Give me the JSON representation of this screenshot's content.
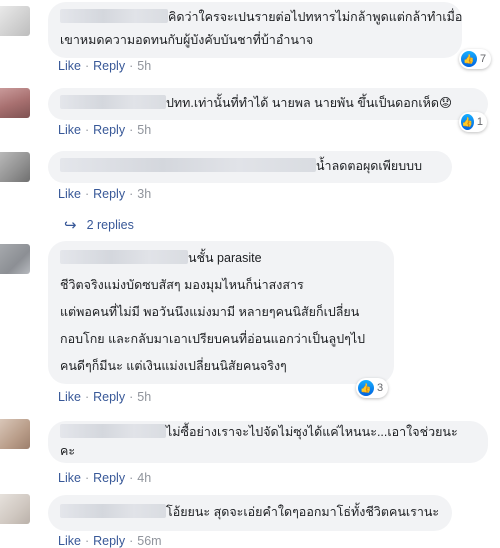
{
  "comments": [
    {
      "lines": [
        "คิดว่าใครจะเปนรายต่อไปทหารไม่กล้าพูดแต่กล้าทำเมื่อ",
        "เขาหมดความอดทนกับผู้บังคับบันชาที่บ้าอำนาจ"
      ],
      "reactions": "7",
      "like": "Like",
      "reply": "Reply",
      "time": "5h"
    },
    {
      "lines": [
        "ปทท.เท่านั้นที่ทำได้ นายพล นายพัน ขึ้นเป็นดอกเห็ด😟"
      ],
      "reactions": "1",
      "like": "Like",
      "reply": "Reply",
      "time": "5h"
    },
    {
      "lines": [
        "น้ำลดตอผุดเพียบบบ"
      ],
      "like": "Like",
      "reply": "Reply",
      "time": "3h",
      "replies_label": "2 replies"
    },
    {
      "lines": [
        "นชั้น parasite",
        "ชีวิตจริงแม่งบัดซบสัสๆ มองมุมไหนก็น่าสงสาร",
        "แต่พอคนที่ไม่มี พอวันนึงแม่งมามี หลายๆคนนิสัยก็เปลี่ยน",
        "กอบโกย และกลับมาเอาเปรียบคนที่อ่อนแอกว่าเป็นลูปๆไป",
        "คนดีๆก็มีนะ แต่เงินแม่งเปลี่ยนนิสัยคนจริงๆ"
      ],
      "reactions": "3",
      "like": "Like",
      "reply": "Reply",
      "time": "5h"
    },
    {
      "lines": [
        "ไม่ซื้อย่างเราจะไปจัดไม่ซุงได้แค่ไหนนะ...เอาใจช่วยนะ",
        "คะ"
      ],
      "like": "Like",
      "reply": "Reply",
      "time": "4h"
    },
    {
      "lines": [
        "โอ้ยยนะ สุดจะเอ่ยคำใดๆออกมาโธ่ทั้งชีวิตคนเรานะ"
      ],
      "like": "Like",
      "reply": "Reply",
      "time": "56m"
    }
  ],
  "colors": {
    "bubble": "#f2f3f5",
    "link": "#385898",
    "meta": "#90949c",
    "like_blue": "#1877f2"
  },
  "icons": {
    "reaction": "thumbs-up-icon",
    "reply_arrow": "reply-arrow-icon"
  }
}
